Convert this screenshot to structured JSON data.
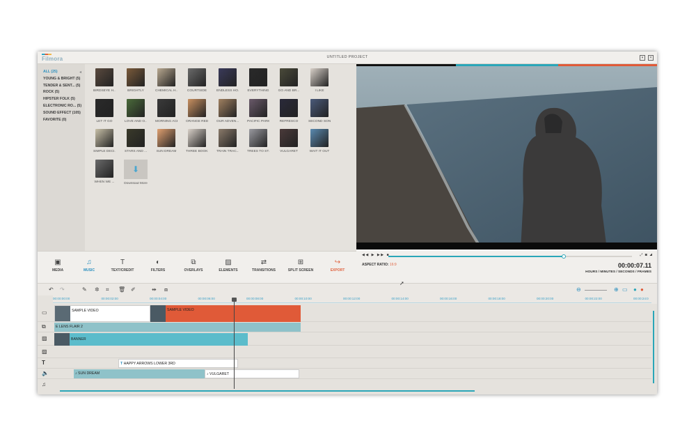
{
  "app": {
    "logo": "Filmora",
    "project_title": "UNTITLED PROJECT"
  },
  "categories": [
    {
      "label": "ALL (25)",
      "active": true
    },
    {
      "label": "YOUNG & BRIGHT (5)",
      "active": false
    },
    {
      "label": "TENDER & SENT... (5)",
      "active": false
    },
    {
      "label": "ROCK (5)",
      "active": false
    },
    {
      "label": "HIPSTER FOLK (5)",
      "active": false
    },
    {
      "label": "ELECTRONIC RO... (5)",
      "active": false
    },
    {
      "label": "SOUND EFFECT (105)",
      "active": false
    },
    {
      "label": "FAVORITE (0)",
      "active": false
    }
  ],
  "library_items": [
    {
      "label": "BIRDSEYE H...",
      "color": "#5a4a3e"
    },
    {
      "label": "BRIGHTLY",
      "color": "#7a5a3a"
    },
    {
      "label": "CHEMICAL H...",
      "color": "#b8a890"
    },
    {
      "label": "COURTSIDE",
      "color": "#6a6a6a"
    },
    {
      "label": "ENDLESS HO...",
      "color": "#3a3a5a"
    },
    {
      "label": "EVERYTHING",
      "color": "#2a2a2a"
    },
    {
      "label": "GO AND BR...",
      "color": "#4a4a3a"
    },
    {
      "label": "I LIKE",
      "color": "#d8d0c8"
    },
    {
      "label": "LET IT GO",
      "color": "#2a2a2a"
    },
    {
      "label": "LOVE AND O...",
      "color": "#4a6a3a"
    },
    {
      "label": "MORNING ACE",
      "color": "#3a3a3a"
    },
    {
      "label": "ORANGE RED",
      "color": "#c89060"
    },
    {
      "label": "OUR ADVEN...",
      "color": "#a08060"
    },
    {
      "label": "PACIFIC PARK",
      "color": "#6a5a6a"
    },
    {
      "label": "REFRESCO",
      "color": "#2a2a3a"
    },
    {
      "label": "SECOND SON",
      "color": "#4a5a7a"
    },
    {
      "label": "SIMPLE DECI...",
      "color": "#c8c0a8"
    },
    {
      "label": "STARS AND ...",
      "color": "#3a3a2a"
    },
    {
      "label": "SUN DREAM",
      "color": "#e0a070"
    },
    {
      "label": "THREE BOOKS",
      "color": "#d8d0c8"
    },
    {
      "label": "TRAIN TRAC...",
      "color": "#8a7a6a"
    },
    {
      "label": "TREES TO ST...",
      "color": "#9a9aa0"
    },
    {
      "label": "VULGARET",
      "color": "#4a3a3a"
    },
    {
      "label": "WAIT IT OUT",
      "color": "#5a8ab0"
    },
    {
      "label": "WHEN WE ...",
      "color": "#6a6a6a"
    }
  ],
  "download_more": "Download More",
  "toolbar": [
    {
      "label": "MEDIA",
      "icon": "media-icon",
      "glyph": "▣",
      "state": "normal"
    },
    {
      "label": "MUSIC",
      "icon": "music-icon",
      "glyph": "♫",
      "state": "active"
    },
    {
      "label": "TEXT/CREDIT",
      "icon": "text-icon",
      "glyph": "T",
      "state": "normal"
    },
    {
      "label": "FILTERS",
      "icon": "filters-icon",
      "glyph": "◐",
      "state": "normal"
    },
    {
      "label": "OVERLAYS",
      "icon": "overlays-icon",
      "glyph": "⧉",
      "state": "normal"
    },
    {
      "label": "ELEMENTS",
      "icon": "elements-icon",
      "glyph": "▨",
      "state": "normal"
    },
    {
      "label": "TRANSITIONS",
      "icon": "transitions-icon",
      "glyph": "⇄",
      "state": "normal"
    },
    {
      "label": "SPLIT SCREEN",
      "icon": "split-screen-icon",
      "glyph": "⊞",
      "state": "normal"
    },
    {
      "label": "EXPORT",
      "icon": "export-icon",
      "glyph": "↪",
      "state": "export"
    }
  ],
  "player": {
    "aspect_label": "ASPECT RATIO:",
    "aspect_value": "16:9",
    "timecode": "00:00:07.11",
    "timecode_format": "HOURS / MINUTES / SECONDS / FRAMES",
    "progress": 0.72
  },
  "ruler_ticks": [
    "00:00:00:00",
    "00:00:02:00",
    "00:00:04:00",
    "00:00:06:00",
    "00:00:08:00",
    "00:00:10:00",
    "00:00:12:00",
    "00:00:14:00",
    "00:00:16:00",
    "00:00:18:00",
    "00:00:20:00",
    "00:00:22:00",
    "00:00:24:0"
  ],
  "tracks": {
    "video_clip_1": "SAMPLE VIDEO",
    "video_clip_2": "SAMPLE VIDEO",
    "overlay_clip": "LENS FLAIR 2",
    "pip_clip": "BANNER",
    "text_clip": "HAPPY ARROWS LOWER 3RD",
    "audio_clip_1": "SUN DREAM",
    "audio_clip_2": "VULGARET"
  },
  "colors": {
    "accent": "#2aa6b8",
    "selected_clip": "#e05a38",
    "export": "#e06340"
  }
}
